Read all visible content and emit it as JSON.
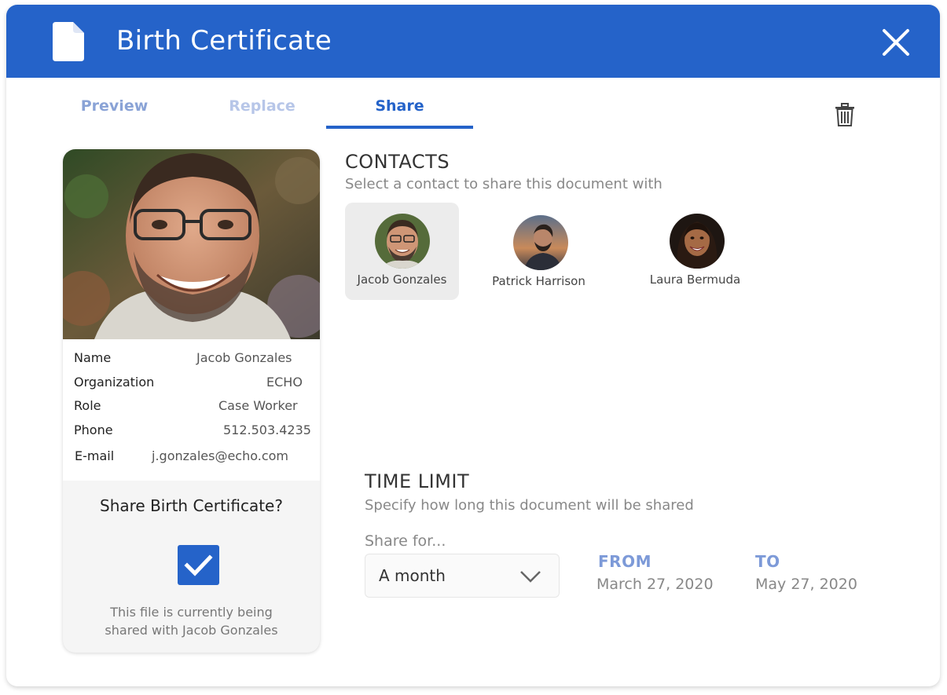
{
  "header": {
    "title": "Birth Certificate"
  },
  "tabs": [
    {
      "label": "Preview",
      "active": false
    },
    {
      "label": "Replace",
      "active": false
    },
    {
      "label": "Share",
      "active": true
    }
  ],
  "profile": {
    "rows": [
      {
        "label": "Name",
        "value": "Jacob Gonzales"
      },
      {
        "label": "Organization",
        "value": "ECHO"
      },
      {
        "label": "Role",
        "value": "Case Worker"
      },
      {
        "label": "Phone",
        "value": "512.503.4235"
      },
      {
        "label": "E-mail",
        "value": "j.gonzales@echo.com"
      }
    ],
    "share_question": "Share Birth Certificate?",
    "share_checked": true,
    "share_note_line1": "This file is currently being",
    "share_note_line2": "shared with Jacob Gonzales"
  },
  "contacts": {
    "title": "CONTACTS",
    "subtitle": "Select a contact to share this document with",
    "items": [
      {
        "name": "Jacob Gonzales",
        "selected": true
      },
      {
        "name": "Patrick Harrison",
        "selected": false
      },
      {
        "name": "Laura Bermuda",
        "selected": false
      }
    ]
  },
  "time_limit": {
    "title": "TIME LIMIT",
    "subtitle": "Specify how long this document will be shared",
    "share_for_label": "Share for...",
    "duration": "A month",
    "from_label": "FROM",
    "from_value": "March 27, 2020",
    "to_label": "TO",
    "to_value": "May 27, 2020"
  },
  "colors": {
    "accent": "#2563c9",
    "tab_inactive": "#8aa3d6",
    "date_label": "#7d9ad8"
  }
}
